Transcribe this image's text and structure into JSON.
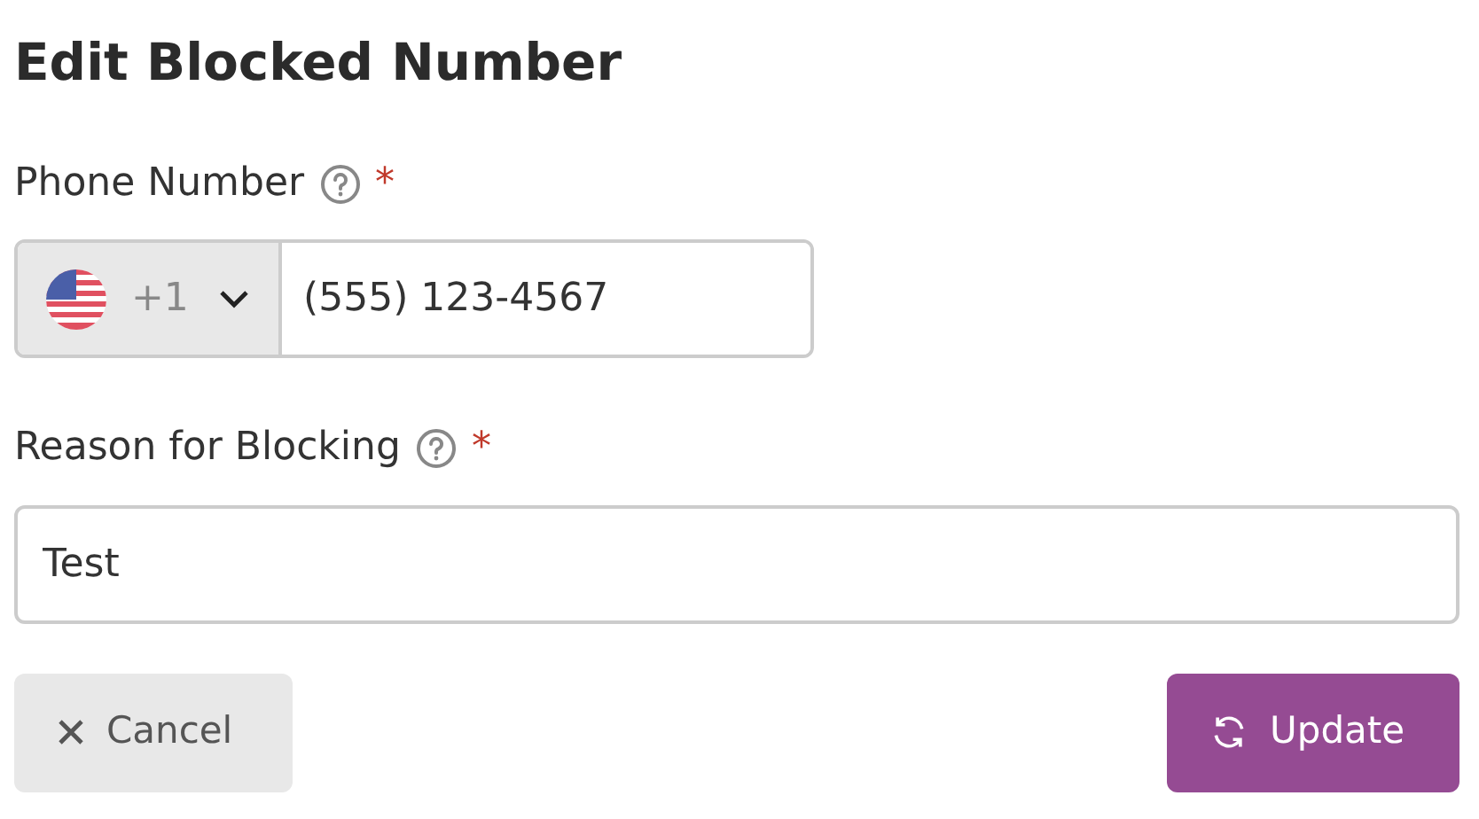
{
  "title": "Edit Blocked Number",
  "fields": [
    {
      "kind": "phone",
      "label": "Phone Number",
      "required_mark": "*",
      "country_code": "+1",
      "value": "(555) 123-4567"
    },
    {
      "kind": "text",
      "label": "Reason for Blocking",
      "required_mark": "*",
      "value": "Test"
    }
  ],
  "buttons": [
    {
      "kind": "cancel",
      "label": "Cancel"
    },
    {
      "kind": "update",
      "label": "Update"
    }
  ]
}
